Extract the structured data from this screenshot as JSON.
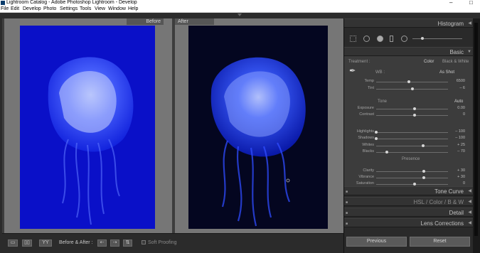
{
  "window": {
    "title": "Lightroom Catalog - Adobe Photoshop Lightroom - Develop",
    "controls": [
      "–",
      "□"
    ]
  },
  "menu": [
    "File",
    "Edit",
    "Develop",
    "Photo",
    "Settings",
    "Tools",
    "View",
    "Window",
    "Help"
  ],
  "compare": {
    "before_label": "Before",
    "after_label": "After"
  },
  "toolbar": {
    "view_buttons": [
      "▭",
      "▯▯",
      "YY"
    ],
    "before_after_label": "Before & After :",
    "copy_buttons": [
      "⇠",
      "⇢",
      "⇅"
    ],
    "soft_proofing": "Soft Proofing"
  },
  "right_panel": {
    "histogram": "Histogram",
    "basic": "Basic",
    "treatment_label": "Treatment :",
    "treatment_options": [
      "Color",
      "Black & White"
    ],
    "wb_label": "WB :",
    "wb_value": "As Shot",
    "tone_label": "Tone",
    "tone_auto": "Auto",
    "presence_label": "Presence",
    "sliders": [
      {
        "label": "Temp",
        "value": "6500",
        "pos": 0.46
      },
      {
        "label": "Tint",
        "value": "– 6",
        "pos": 0.5
      },
      {
        "label": "Exposure",
        "value": "0.00",
        "pos": 0.53
      },
      {
        "label": "Contrast",
        "value": "0",
        "pos": 0.53
      },
      {
        "label": "Highlights",
        "value": "– 100",
        "pos": 0.0
      },
      {
        "label": "Shadows",
        "value": "– 100",
        "pos": 0.0
      },
      {
        "label": "Whites",
        "value": "+ 25",
        "pos": 0.65
      },
      {
        "label": "Blacks",
        "value": "– 70",
        "pos": 0.15
      },
      {
        "label": "Clarity",
        "value": "+ 30",
        "pos": 0.66
      },
      {
        "label": "Vibrance",
        "value": "+ 30",
        "pos": 0.66
      },
      {
        "label": "Saturation",
        "value": "0",
        "pos": 0.53
      }
    ],
    "tone_curve": "Tone Curve",
    "hsl_tabs": [
      "HSL",
      "/",
      "Color",
      "/",
      "B & W"
    ],
    "detail": "Detail",
    "lens_corrections": "Lens Corrections",
    "previous_button": "Previous",
    "reset_button": "Reset"
  },
  "colors": {
    "before_bg": "#0a10c8",
    "after_bg": "#040620",
    "panel_bg": "#3c3c3c"
  }
}
